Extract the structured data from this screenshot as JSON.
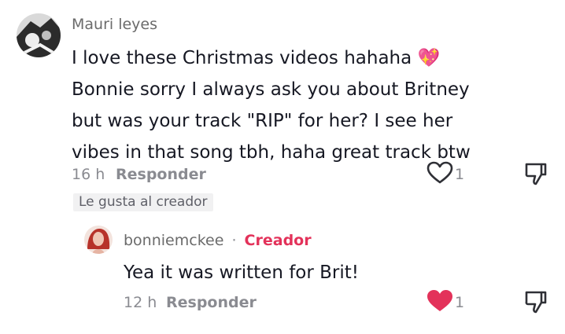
{
  "comment": {
    "username": "Mauri leyes",
    "text_lines": [
      "I love these Christmas videos hahaha 💖",
      "Bonnie sorry I always ask you about Britney",
      "but was your track \"RIP\" for her? I see her",
      "vibes in that song tbh, haha great track btw"
    ],
    "time": "16 h",
    "reply_label": "Responder",
    "like_count": "1",
    "liked_by_creator": "Le gusta al creador",
    "liked": false
  },
  "reply": {
    "username": "bonniemckee",
    "separator": "·",
    "creator_label": "Creador",
    "text": "Yea it was written for Brit!",
    "time": "12 h",
    "reply_label": "Responder",
    "like_count": "1",
    "liked": true
  },
  "colors": {
    "accent": "#e3325a",
    "text": "#161823",
    "muted": "#8a8b91"
  },
  "icons": {
    "heart_outline": "heart-outline-icon",
    "heart_filled": "heart-filled-icon",
    "dislike": "thumbs-down-icon",
    "sparkle_heart": "sparkling-heart-emoji"
  }
}
